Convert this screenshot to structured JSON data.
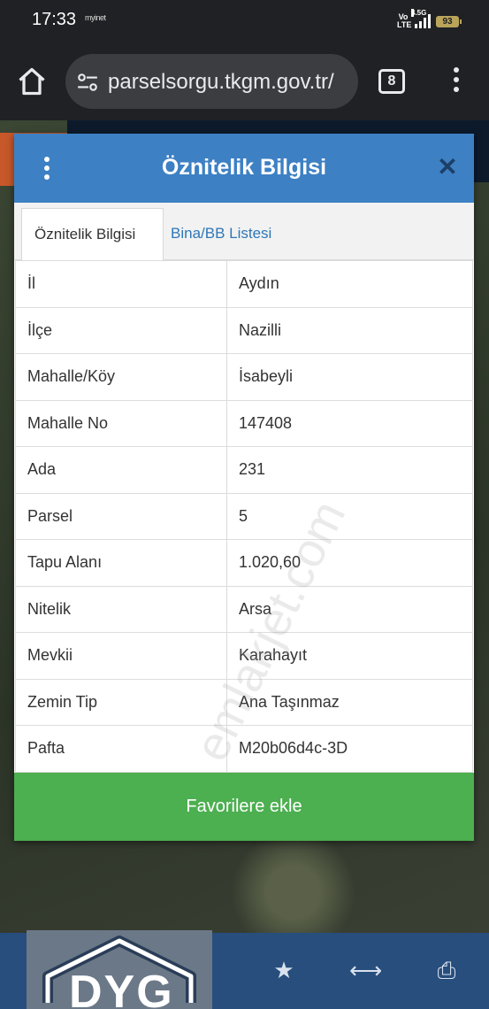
{
  "status_bar": {
    "time": "17:33",
    "notification_text": "myinet",
    "volte_label": "Vo\nLTE",
    "network_label": "4.5G",
    "battery_level": "93"
  },
  "browser": {
    "url": "parselsorgu.tkgm.gov.tr/",
    "tab_count": "8",
    "icons": [
      "home-icon",
      "tune-icon",
      "tab-switcher-icon",
      "more-vert-icon"
    ]
  },
  "dialog": {
    "title": "Öznitelik Bilgisi",
    "close_icon": "close-icon",
    "tabs": [
      {
        "label": "Öznitelik Bilgisi",
        "active": true
      },
      {
        "label": "Bina/BB Listesi",
        "active": false
      }
    ],
    "rows": [
      {
        "key": "İl",
        "value": "Aydın"
      },
      {
        "key": "İlçe",
        "value": "Nazilli"
      },
      {
        "key": "Mahalle/Köy",
        "value": "İsabeyli"
      },
      {
        "key": "Mahalle No",
        "value": "147408"
      },
      {
        "key": "Ada",
        "value": "231"
      },
      {
        "key": "Parsel",
        "value": "5"
      },
      {
        "key": "Tapu Alanı",
        "value": "1.020,60"
      },
      {
        "key": "Nitelik",
        "value": "Arsa"
      },
      {
        "key": "Mevkii",
        "value": "Karahayıt"
      },
      {
        "key": "Zemin Tip",
        "value": "Ana Taşınmaz"
      },
      {
        "key": "Pafta",
        "value": "M20b06d4c-3D"
      }
    ],
    "favorite_button": "Favorilere ekle"
  },
  "watermark": "emlakjet.com",
  "logo": "DYG",
  "toolbar_icons": [
    "refresh-icon",
    "swap-icon",
    "info-icon",
    "star-icon",
    "measure-icon",
    "print-icon"
  ],
  "colors": {
    "header_blue": "#3d80c4",
    "tab_link_blue": "#2e77b8",
    "button_green": "#4caf50",
    "toolbar_blue": "#274e7d"
  }
}
